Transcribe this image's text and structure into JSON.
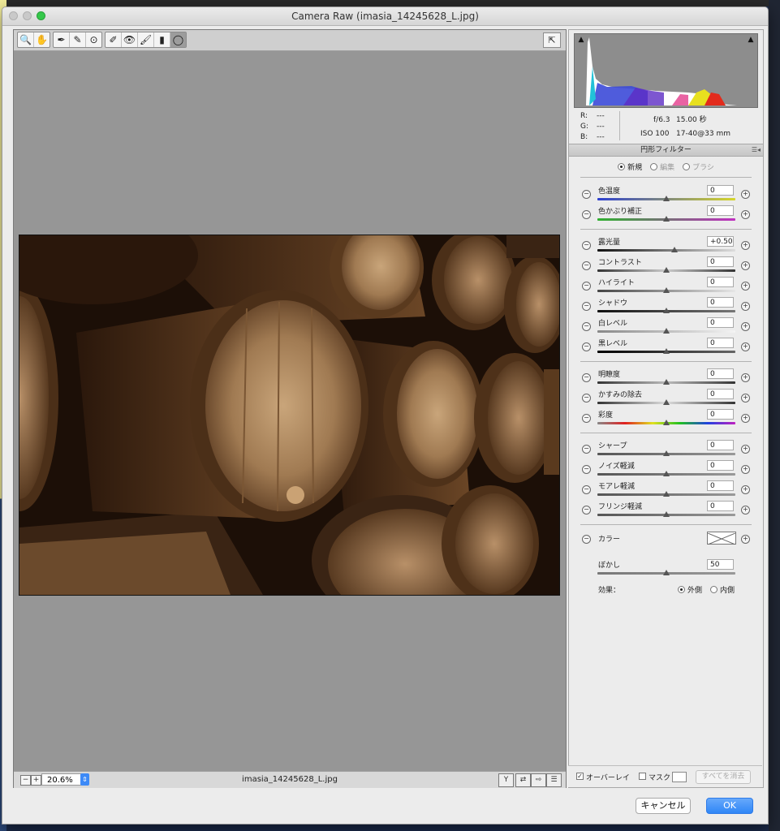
{
  "window": {
    "title": "Camera Raw (imasia_14245628_L.jpg)"
  },
  "toolbar": {
    "tools": [
      "zoom-tool-icon",
      "hand-tool-icon",
      "white-balance-tool-icon",
      "color-sampler-tool-icon",
      "targeted-adjustment-tool-icon",
      "spot-removal-tool-icon",
      "red-eye-tool-icon",
      "adjustment-brush-icon",
      "graduated-filter-icon",
      "radial-filter-icon"
    ]
  },
  "status": {
    "zoom": "20.6%",
    "filename": "imasia_14245628_L.jpg"
  },
  "info": {
    "r_label": "R:",
    "g_label": "G:",
    "b_label": "B:",
    "r": "---",
    "g": "---",
    "b": "---",
    "aperture": "f/6.3",
    "shutter": "15.00 秒",
    "iso": "ISO 100",
    "lens": "17-40@33 mm"
  },
  "panel": {
    "title": "円形フィルター",
    "modes": {
      "new": "新規",
      "edit": "編集",
      "brush": "ブラシ"
    }
  },
  "sliders": {
    "temp": {
      "label": "色温度",
      "value": "0",
      "pos": 0.5
    },
    "tint": {
      "label": "色かぶり補正",
      "value": "0",
      "pos": 0.5
    },
    "exposure": {
      "label": "露光量",
      "value": "+0.50",
      "pos": 0.56
    },
    "contrast": {
      "label": "コントラスト",
      "value": "0",
      "pos": 0.5
    },
    "highlights": {
      "label": "ハイライト",
      "value": "0",
      "pos": 0.5
    },
    "shadows": {
      "label": "シャドウ",
      "value": "0",
      "pos": 0.5
    },
    "whites": {
      "label": "白レベル",
      "value": "0",
      "pos": 0.5
    },
    "blacks": {
      "label": "黒レベル",
      "value": "0",
      "pos": 0.5
    },
    "clarity": {
      "label": "明瞭度",
      "value": "0",
      "pos": 0.5
    },
    "dehaze": {
      "label": "かすみの除去",
      "value": "0",
      "pos": 0.5
    },
    "saturation": {
      "label": "彩度",
      "value": "0",
      "pos": 0.5
    },
    "sharpness": {
      "label": "シャープ",
      "value": "0",
      "pos": 0.5
    },
    "noise": {
      "label": "ノイズ軽減",
      "value": "0",
      "pos": 0.5
    },
    "moire": {
      "label": "モアレ軽減",
      "value": "0",
      "pos": 0.5
    },
    "defringe": {
      "label": "フリンジ軽減",
      "value": "0",
      "pos": 0.5
    },
    "feather": {
      "label": "ぼかし",
      "value": "50",
      "pos": 0.5
    }
  },
  "color": {
    "label": "カラー"
  },
  "effect": {
    "label": "効果：",
    "outside": "外側",
    "inside": "内側"
  },
  "bottom": {
    "overlay": "オーバーレイ",
    "mask": "マスク",
    "clear_all": "すべてを消去"
  },
  "buttons": {
    "cancel": "キャンセル",
    "ok": "OK"
  },
  "colors": {
    "accent": "#2f86f6"
  }
}
